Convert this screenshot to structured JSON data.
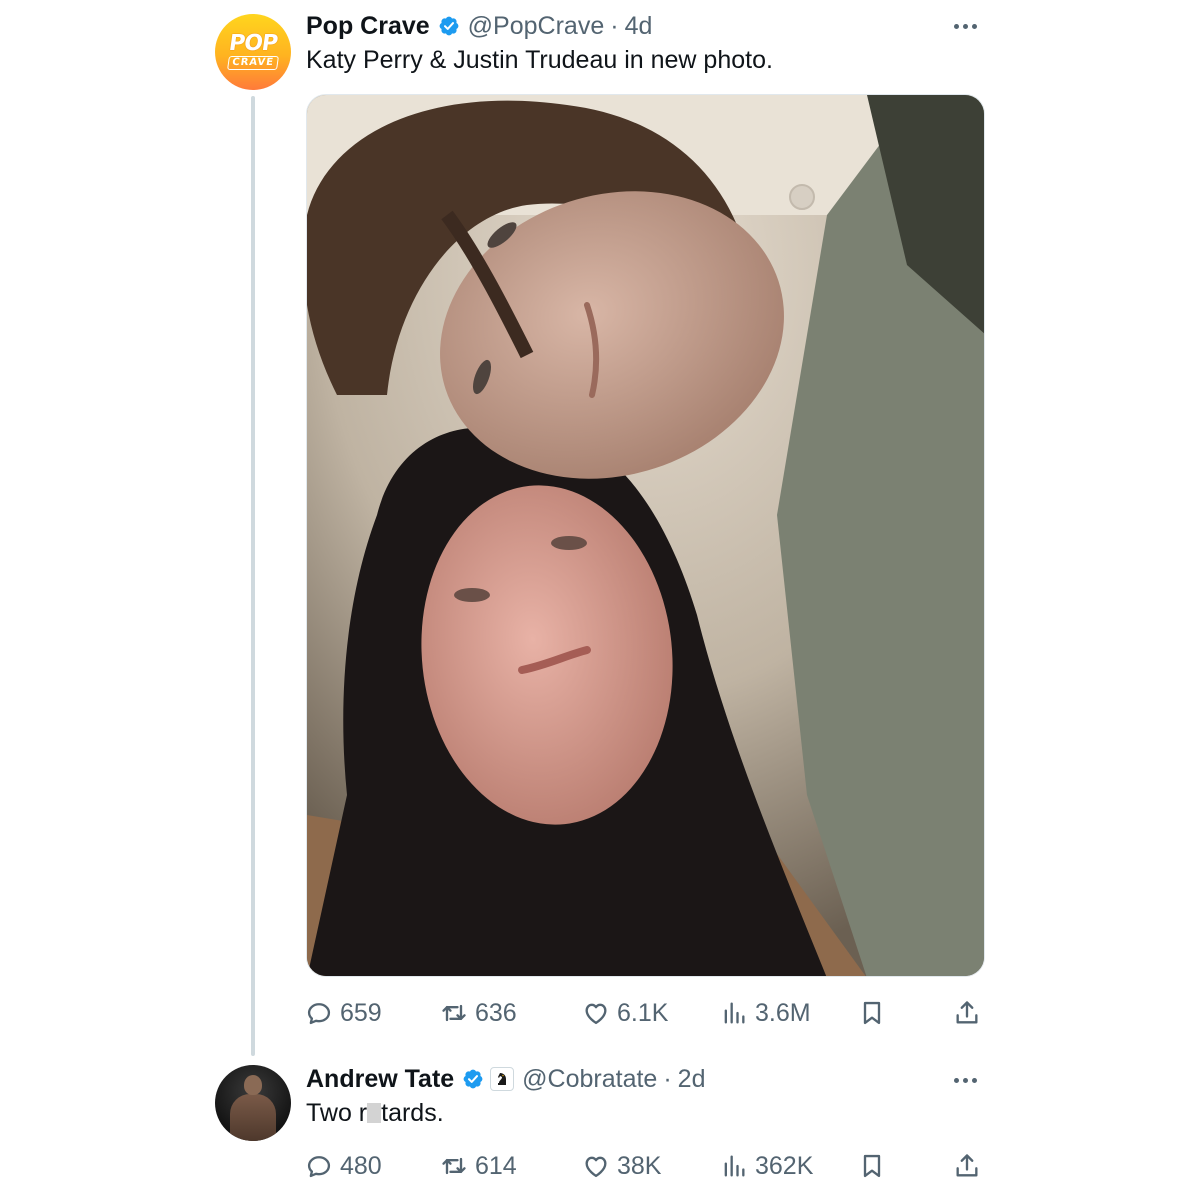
{
  "thread": [
    {
      "display_name": "Pop Crave",
      "handle": "@PopCrave",
      "time": "4d",
      "text": "Katy Perry & Justin Trudeau in new photo.",
      "avatar_text": {
        "top": "POP",
        "bottom": "CRAVE"
      },
      "verified": true,
      "has_photo": true,
      "stats": {
        "replies": "659",
        "reposts": "636",
        "likes": "6.1K",
        "views": "3.6M"
      }
    },
    {
      "display_name": "Andrew Tate",
      "handle": "@Cobratate",
      "time": "2d",
      "text_before_censor": "Two r",
      "text_after_censor": "tards.",
      "verified": true,
      "affiliate_badge": true,
      "stats": {
        "replies": "480",
        "reposts": "614",
        "likes": "38K",
        "views": "362K"
      }
    }
  ],
  "separator": "·",
  "icons": [
    "reply-icon",
    "repost-icon",
    "like-icon",
    "views-icon",
    "bookmark-icon",
    "share-icon",
    "more-icon",
    "verified-badge-icon"
  ],
  "colors": {
    "verified": "#1d9bf0",
    "secondary_text": "#536471",
    "thread_line": "#cfd9de",
    "primary_text": "#0f1419"
  }
}
